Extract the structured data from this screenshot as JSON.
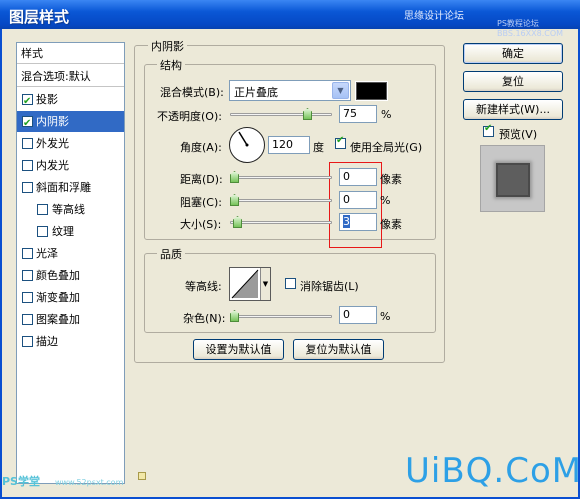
{
  "window": {
    "title": "图层样式",
    "watermark": "思缘设计论坛",
    "watermark2": "PS教程论坛 BBS.16XX8.COM"
  },
  "sidebar": {
    "items": [
      {
        "label": "样式",
        "checkbox": false
      },
      {
        "label": "混合选项:默认",
        "checkbox": false
      },
      {
        "label": "投影",
        "checkbox": true,
        "checked": true
      },
      {
        "label": "内阴影",
        "checkbox": true,
        "checked": true,
        "selected": true
      },
      {
        "label": "外发光",
        "checkbox": true,
        "checked": false
      },
      {
        "label": "内发光",
        "checkbox": true,
        "checked": false
      },
      {
        "label": "斜面和浮雕",
        "checkbox": true,
        "checked": false
      },
      {
        "label": "等高线",
        "checkbox": true,
        "checked": false,
        "sub": true
      },
      {
        "label": "纹理",
        "checkbox": true,
        "checked": false,
        "sub": true
      },
      {
        "label": "光泽",
        "checkbox": true,
        "checked": false
      },
      {
        "label": "颜色叠加",
        "checkbox": true,
        "checked": false
      },
      {
        "label": "渐变叠加",
        "checkbox": true,
        "checked": false
      },
      {
        "label": "图案叠加",
        "checkbox": true,
        "checked": false
      },
      {
        "label": "描边",
        "checkbox": true,
        "checked": false
      }
    ]
  },
  "inner_shadow": {
    "title": "内阴影",
    "structure": {
      "title": "结构",
      "blend_mode_label": "混合模式(B):",
      "blend_mode_value": "正片叠底",
      "shadow_color": "#000000",
      "opacity_label": "不透明度(O):",
      "opacity_value": "75",
      "opacity_unit": "%",
      "angle_label": "角度(A):",
      "angle_value": "120",
      "angle_unit": "度",
      "global_light_label": "使用全局光(G)",
      "global_light_checked": true,
      "distance_label": "距离(D):",
      "distance_value": "0",
      "distance_unit": "像素",
      "choke_label": "阻塞(C):",
      "choke_value": "0",
      "choke_unit": "%",
      "size_label": "大小(S):",
      "size_value": "3",
      "size_unit": "像素"
    },
    "quality": {
      "title": "品质",
      "contour_label": "等高线:",
      "anti_alias_label": "消除锯齿(L)",
      "anti_alias_checked": false,
      "noise_label": "杂色(N):",
      "noise_value": "0",
      "noise_unit": "%"
    },
    "set_default_label": "设置为默认值",
    "reset_default_label": "复位为默认值"
  },
  "actions": {
    "ok_label": "确定",
    "reset_label": "复位",
    "new_style_label": "新建样式(W)...",
    "preview_label": "预览(V)",
    "preview_checked": true
  },
  "watermarks": {
    "bottom_left": "PS学堂",
    "bottom_left_url": "www.52psxt.com",
    "bottom_right": "UiBQ.CoM"
  }
}
